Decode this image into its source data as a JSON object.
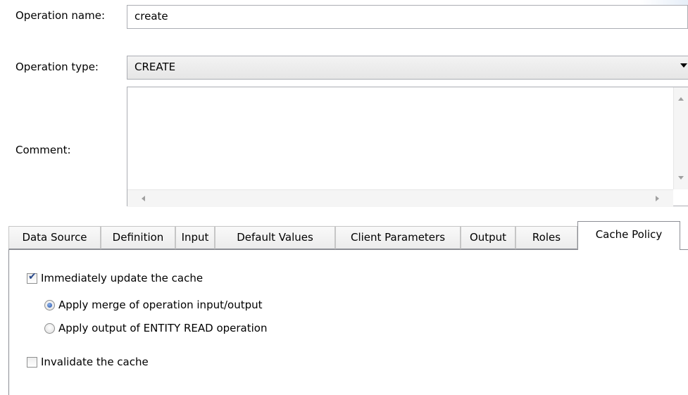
{
  "form": {
    "operation_name_label": "Operation name:",
    "operation_name_value": "create",
    "operation_type_label": "Operation type:",
    "operation_type_value": "CREATE",
    "comment_label": "Comment:",
    "comment_value": ""
  },
  "tabs": [
    {
      "label": "Data Source",
      "active": false
    },
    {
      "label": "Definition",
      "active": false
    },
    {
      "label": "Input",
      "active": false
    },
    {
      "label": "Default Values",
      "active": false
    },
    {
      "label": "Client Parameters",
      "active": false
    },
    {
      "label": "Output",
      "active": false
    },
    {
      "label": "Roles",
      "active": false
    },
    {
      "label": "Cache Policy",
      "active": true
    }
  ],
  "cache_policy": {
    "immediately_update": {
      "label": "Immediately update the cache",
      "checked": true
    },
    "apply_merge": {
      "label": "Apply merge of operation input/output",
      "selected": true
    },
    "apply_output": {
      "label": "Apply output of ENTITY READ operation",
      "selected": false
    },
    "invalidate": {
      "label": "Invalidate the cache",
      "checked": false
    }
  },
  "icons": {
    "dropdown": "chevron-down-icon",
    "scroll_up": "scroll-up-arrow-icon",
    "scroll_down": "scroll-down-arrow-icon",
    "scroll_left": "scroll-left-arrow-icon",
    "scroll_right": "scroll-right-arrow-icon",
    "checkbox_checked": "checkmark-icon"
  },
  "colors": {
    "border": "#abadb3",
    "tab_border": "#8c8e94",
    "radio_accent": "#1f4ea8"
  }
}
